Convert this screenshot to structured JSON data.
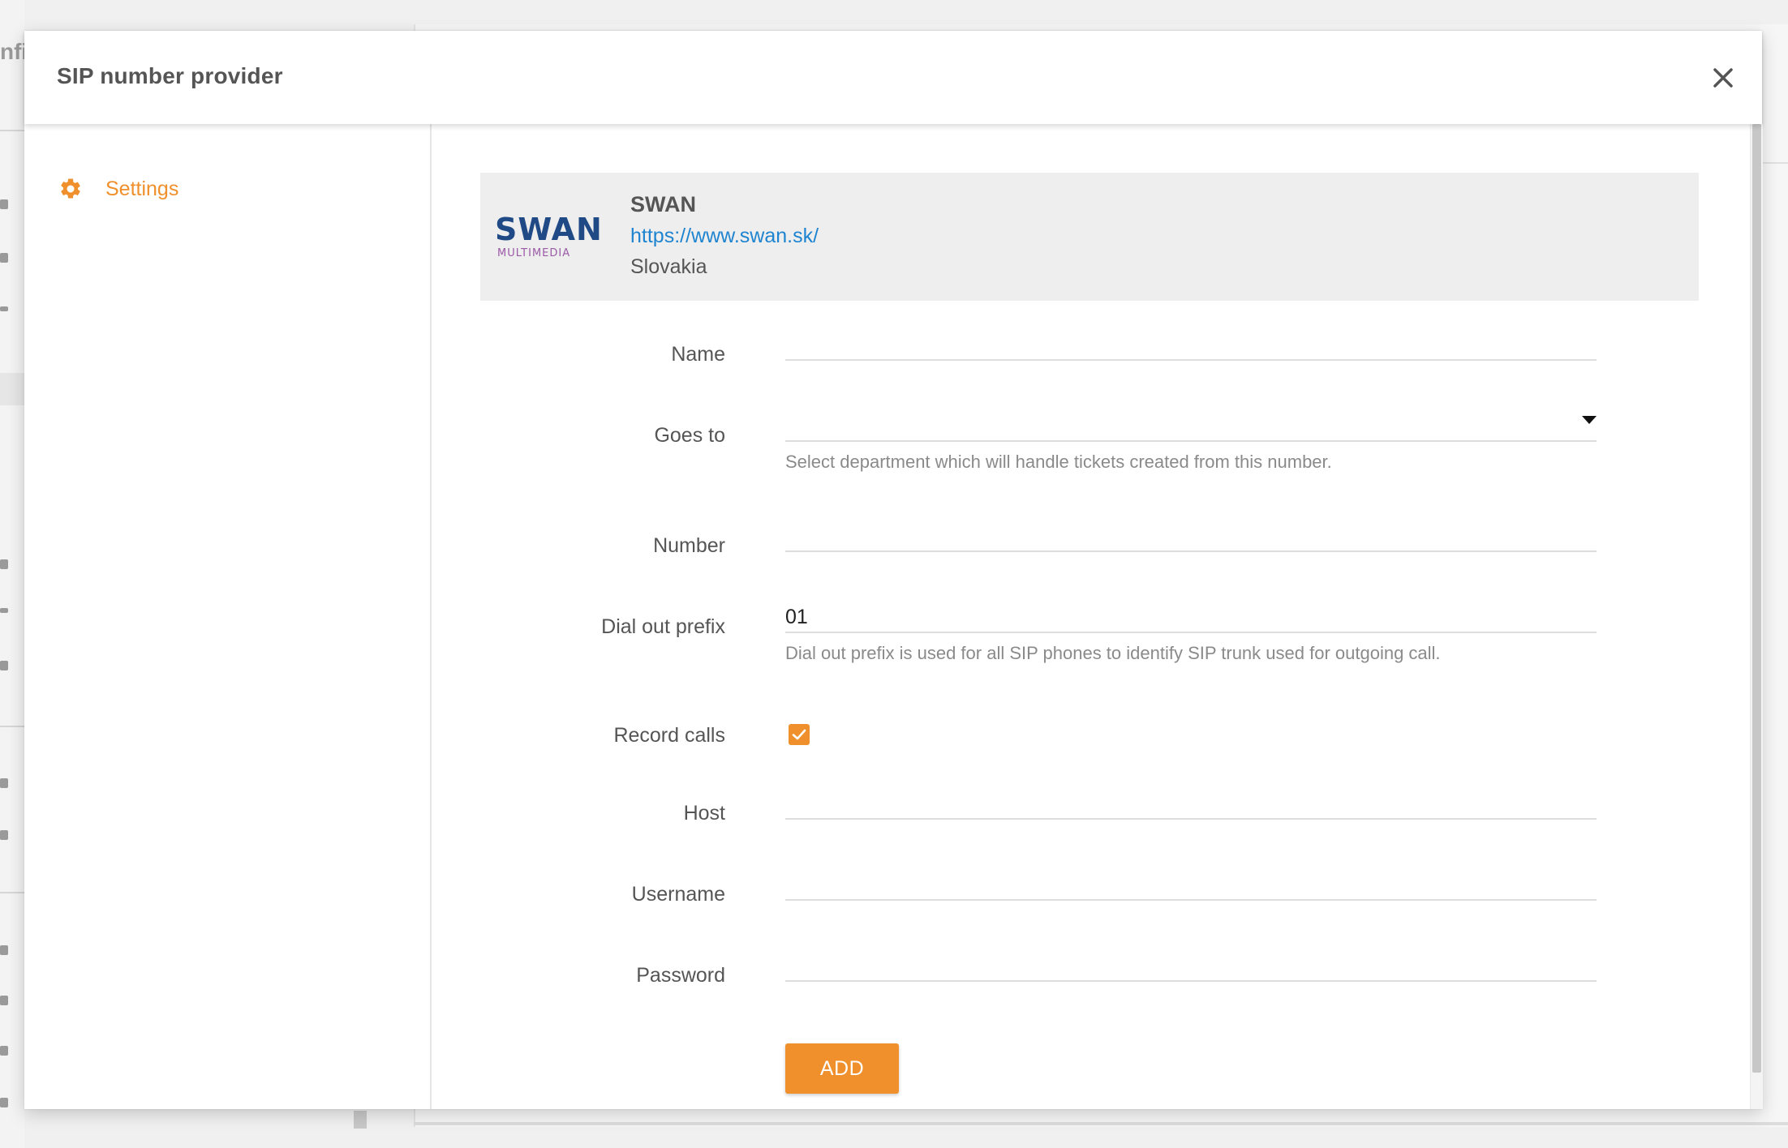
{
  "background": {
    "partial_title": "nfi"
  },
  "modal": {
    "title": "SIP number provider",
    "close_icon": "close-icon"
  },
  "sidebar": {
    "items": [
      {
        "label": "Settings",
        "icon": "gear-icon",
        "active": true
      }
    ]
  },
  "provider": {
    "logo_text": "SWAN",
    "logo_subtext": "MULTIMEDIA",
    "name": "SWAN",
    "url": "https://www.swan.sk/",
    "country": "Slovakia"
  },
  "form": {
    "name": {
      "label": "Name",
      "value": ""
    },
    "goes_to": {
      "label": "Goes to",
      "value": "",
      "help": "Select department which will handle tickets created from this number."
    },
    "number": {
      "label": "Number",
      "value": ""
    },
    "dial_out_prefix": {
      "label": "Dial out prefix",
      "value": "01",
      "help": "Dial out prefix is used for all SIP phones to identify SIP trunk used for outgoing call."
    },
    "record_calls": {
      "label": "Record calls",
      "checked": true
    },
    "host": {
      "label": "Host",
      "value": ""
    },
    "username": {
      "label": "Username",
      "value": ""
    },
    "password": {
      "label": "Password",
      "value": ""
    },
    "submit_label": "ADD"
  },
  "colors": {
    "accent": "#f0902c",
    "link": "#1e84d0",
    "logo_primary": "#1f4a86",
    "logo_secondary": "#9b5aa6"
  }
}
